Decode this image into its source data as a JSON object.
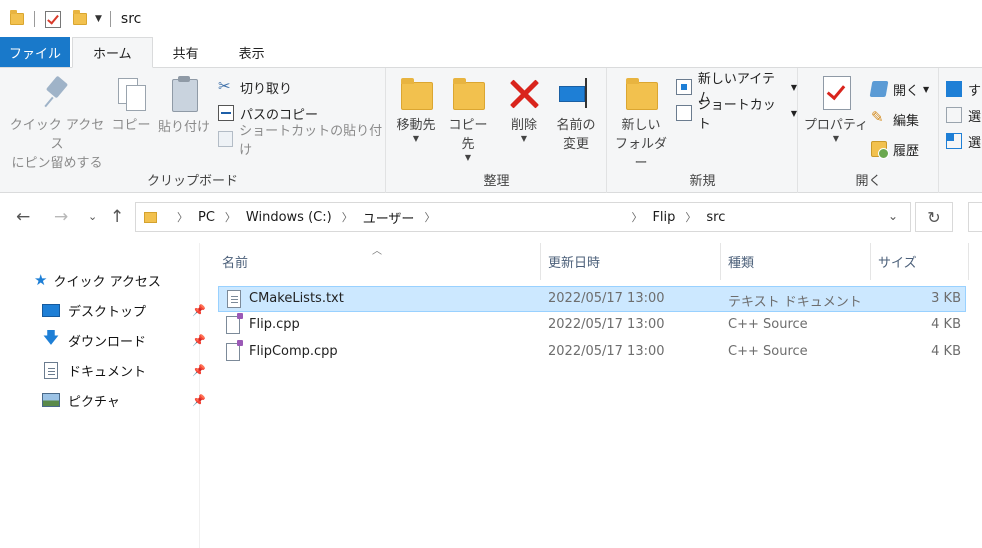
{
  "window": {
    "title": "src"
  },
  "tabs": [
    {
      "label": "ファイル"
    },
    {
      "label": "ホーム"
    },
    {
      "label": "共有"
    },
    {
      "label": "表示"
    }
  ],
  "ribbon": {
    "clipboard": {
      "label": "クリップボード",
      "pin_quick_access": [
        "クイック アクセス",
        "にピン留めする"
      ],
      "copy": "コピー",
      "paste": "貼り付け",
      "cut": "切り取り",
      "copy_path": "パスのコピー",
      "paste_shortcut": "ショートカットの貼り付け"
    },
    "organize": {
      "label": "整理",
      "move_to": "移動先",
      "copy_to": "コピー先",
      "delete": "削除",
      "rename": [
        "名前の",
        "変更"
      ]
    },
    "new": {
      "label": "新規",
      "new_folder": [
        "新しい",
        "フォルダー"
      ],
      "new_item": "新しいアイテム",
      "easy_access": "ショートカット"
    },
    "open": {
      "label": "開く",
      "properties": "プロパティ",
      "open": "開く",
      "edit": "編集",
      "history": "履歴"
    },
    "select": {
      "select_all": "す",
      "select_none": "選",
      "invert": "選"
    }
  },
  "address": {
    "segments": [
      "PC",
      "Windows (C:)",
      "ユーザー",
      "Flip",
      "src"
    ]
  },
  "nav_pane": {
    "quick_access": "クイック アクセス",
    "items": [
      {
        "label": "デスクトップ",
        "icon": "desktop-icon"
      },
      {
        "label": "ダウンロード",
        "icon": "download-icon"
      },
      {
        "label": "ドキュメント",
        "icon": "document-icon"
      },
      {
        "label": "ピクチャ",
        "icon": "pictures-icon"
      }
    ]
  },
  "file_list": {
    "columns": {
      "name": "名前",
      "modified": "更新日時",
      "type": "種類",
      "size": "サイズ"
    },
    "rows": [
      {
        "name": "CMakeLists.txt",
        "modified": "2022/05/17 13:00",
        "type": "テキスト ドキュメント",
        "size": "3 KB",
        "selected": true,
        "icon": "text-file-icon"
      },
      {
        "name": "Flip.cpp",
        "modified": "2022/05/17 13:00",
        "type": "C++ Source",
        "size": "4 KB",
        "selected": false,
        "icon": "cpp-file-icon"
      },
      {
        "name": "FlipComp.cpp",
        "modified": "2022/05/17 13:00",
        "type": "C++ Source",
        "size": "4 KB",
        "selected": false,
        "icon": "cpp-file-icon"
      }
    ]
  },
  "colors": {
    "accent": "#1979ca",
    "selection": "#cce8ff",
    "delete_red": "#d9241c",
    "folder_yellow": "#f2c14e"
  }
}
